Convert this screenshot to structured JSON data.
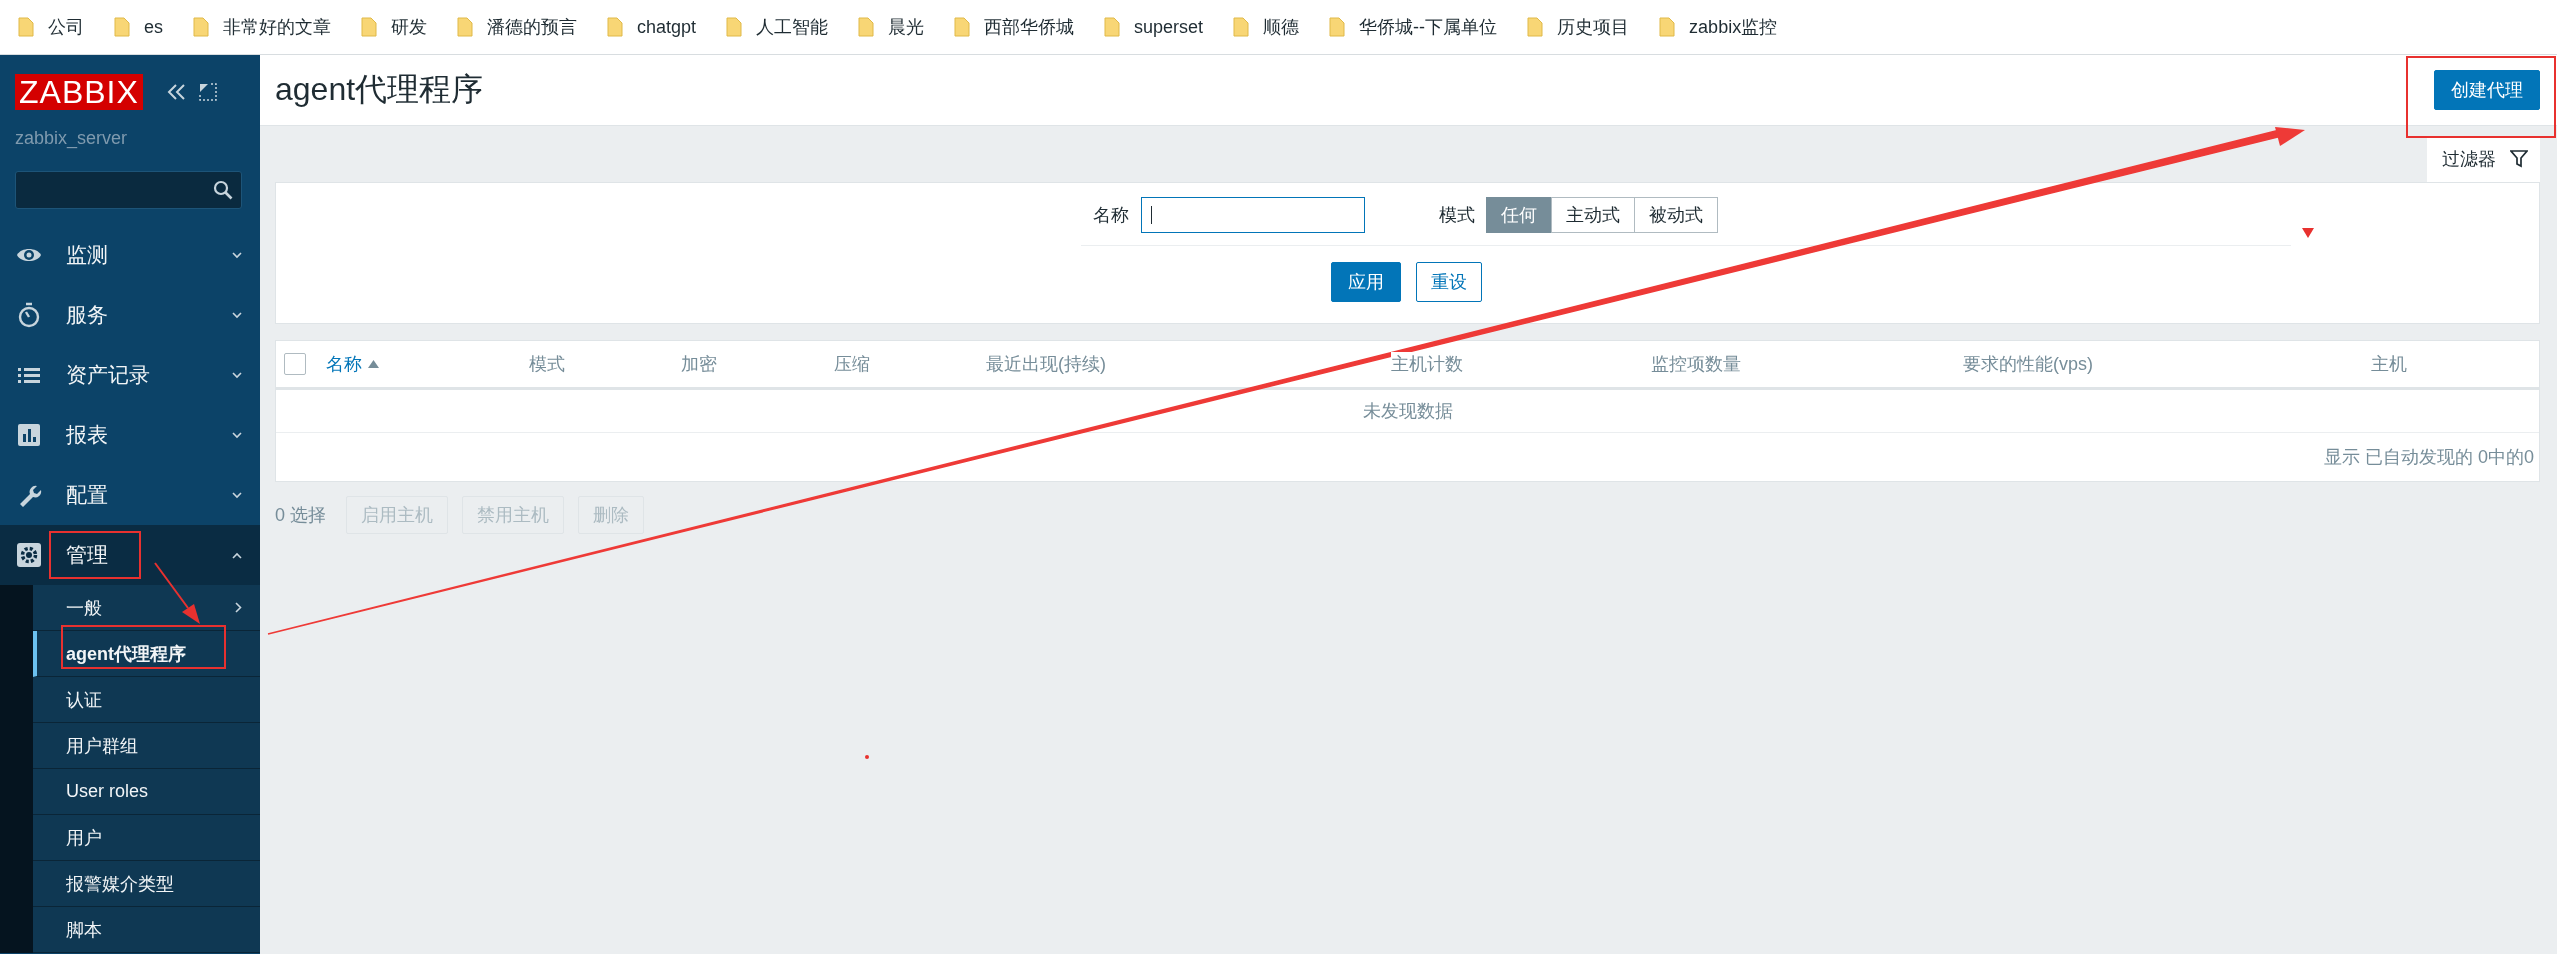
{
  "bookmarks": [
    {
      "label": "公司"
    },
    {
      "label": "es"
    },
    {
      "label": "非常好的文章"
    },
    {
      "label": "研发"
    },
    {
      "label": "潘德的预言"
    },
    {
      "label": "chatgpt"
    },
    {
      "label": "人工智能"
    },
    {
      "label": "晨光"
    },
    {
      "label": "西部华侨城"
    },
    {
      "label": "superset"
    },
    {
      "label": "顺德"
    },
    {
      "label": "华侨城--下属单位"
    },
    {
      "label": "历史项目"
    },
    {
      "label": "zabbix监控"
    }
  ],
  "sidebar": {
    "logo": "ZABBIX",
    "server": "zabbix_server",
    "menu": [
      {
        "label": "监测",
        "kind": "eye",
        "expanded": false
      },
      {
        "label": "服务",
        "kind": "timer",
        "expanded": false
      },
      {
        "label": "资产记录",
        "kind": "list",
        "expanded": false
      },
      {
        "label": "报表",
        "kind": "chart",
        "expanded": false
      },
      {
        "label": "配置",
        "kind": "wrench",
        "expanded": false
      },
      {
        "label": "管理",
        "kind": "gear",
        "expanded": true,
        "children": [
          {
            "label": "一般",
            "selected": false,
            "has_submenu": true
          },
          {
            "label": "agent代理程序",
            "selected": true,
            "has_submenu": false
          },
          {
            "label": "认证",
            "selected": false,
            "has_submenu": false
          },
          {
            "label": "用户群组",
            "selected": false,
            "has_submenu": false
          },
          {
            "label": "User roles",
            "selected": false,
            "has_submenu": false
          },
          {
            "label": "用户",
            "selected": false,
            "has_submenu": false
          },
          {
            "label": "报警媒介类型",
            "selected": false,
            "has_submenu": false
          },
          {
            "label": "脚本",
            "selected": false,
            "has_submenu": false
          }
        ]
      }
    ]
  },
  "header": {
    "title": "agent代理程序",
    "create_button": "创建代理"
  },
  "filter": {
    "tab_label": "过滤器",
    "name_label": "名称",
    "mode_label": "模式",
    "mode_options": [
      {
        "label": "任何",
        "selected": true
      },
      {
        "label": "主动式",
        "selected": false
      },
      {
        "label": "被动式",
        "selected": false
      }
    ],
    "apply_button": "应用",
    "reset_button": "重设"
  },
  "table": {
    "select_all": {
      "checked": false
    },
    "columns": [
      {
        "label": "名称",
        "sorted": true
      },
      {
        "label": "模式",
        "sorted": false
      },
      {
        "label": "加密",
        "sorted": false
      },
      {
        "label": "压缩",
        "sorted": false
      },
      {
        "label": "最近出现(持续)",
        "sorted": false
      },
      {
        "label": "主机计数",
        "sorted": false
      },
      {
        "label": "监控项数量",
        "sorted": false
      },
      {
        "label": "要求的性能(vps)",
        "sorted": false
      },
      {
        "label": "主机",
        "sorted": false
      }
    ],
    "empty_message": "未发现数据",
    "summary": "显示 已自动发现的 0中的0"
  },
  "footer": {
    "selected_count": "0 选择",
    "actions": [
      {
        "label": "启用主机",
        "disabled": true
      },
      {
        "label": "禁用主机",
        "disabled": true
      },
      {
        "label": "删除",
        "disabled": true
      }
    ]
  }
}
